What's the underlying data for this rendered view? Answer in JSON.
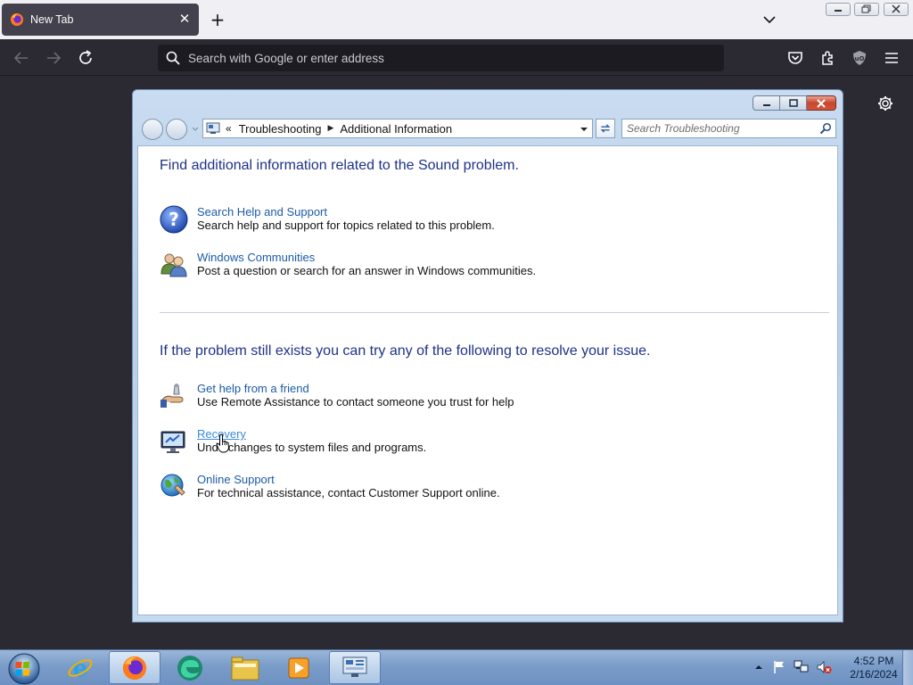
{
  "browser": {
    "tab_title": "New Tab",
    "urlbar_placeholder": "Search with Google or enter address"
  },
  "explorer": {
    "breadcrumb_overflow": "«",
    "breadcrumb": [
      "Troubleshooting",
      "Additional Information"
    ],
    "search_placeholder": "Search Troubleshooting"
  },
  "panel": {
    "heading1": "Find additional information related to the Sound problem.",
    "section1": [
      {
        "icon": "help-question-icon",
        "link": "Search Help and Support",
        "desc": "Search help and support for topics related to this problem."
      },
      {
        "icon": "people-community-icon",
        "link": "Windows Communities",
        "desc": "Post a question or search for an answer in Windows communities."
      }
    ],
    "heading2": "If the problem still exists you can try any of the following to resolve your issue.",
    "section2": [
      {
        "icon": "remote-assistance-icon",
        "link": "Get help from a friend",
        "desc": "Use Remote Assistance to contact someone you trust for help"
      },
      {
        "icon": "recovery-monitor-icon",
        "link": "Recovery",
        "desc": "Undo changes to system files and programs."
      },
      {
        "icon": "globe-support-icon",
        "link": "Online Support",
        "desc": "For technical assistance, contact Customer Support online."
      }
    ]
  },
  "taskbar": {
    "items": [
      "internet-explorer",
      "firefox",
      "edge",
      "file-explorer",
      "media-player",
      "control-panel"
    ],
    "clock_time": "4:52 PM",
    "clock_date": "2/16/2024"
  }
}
